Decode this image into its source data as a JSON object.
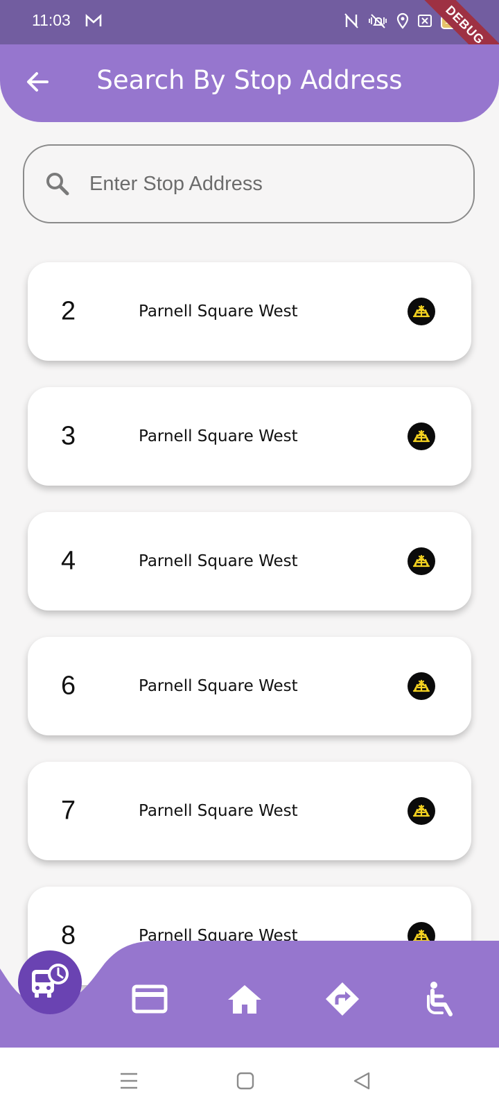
{
  "status_bar": {
    "time": "11:03",
    "battery": "100",
    "debug_label": "DEBUG"
  },
  "app_bar": {
    "title": "Search By Stop Address"
  },
  "search": {
    "placeholder": "Enter Stop Address",
    "value": ""
  },
  "stops": [
    {
      "number": "2",
      "address": "Parnell Square West"
    },
    {
      "number": "3",
      "address": "Parnell Square West"
    },
    {
      "number": "4",
      "address": "Parnell Square West"
    },
    {
      "number": "6",
      "address": "Parnell Square West"
    },
    {
      "number": "7",
      "address": "Parnell Square West"
    },
    {
      "number": "8",
      "address": "Parnell Square West"
    }
  ],
  "bottom_nav": {
    "items": [
      "bus-schedule-icon",
      "card-icon",
      "home-icon",
      "directions-icon",
      "accessibility-icon"
    ]
  },
  "colors": {
    "app_bar": "#9676ce",
    "status_bar": "#725da0",
    "fab": "#6a43b2",
    "operator_logo_bg": "#0b0b0b",
    "operator_logo_fg": "#f5d320"
  }
}
